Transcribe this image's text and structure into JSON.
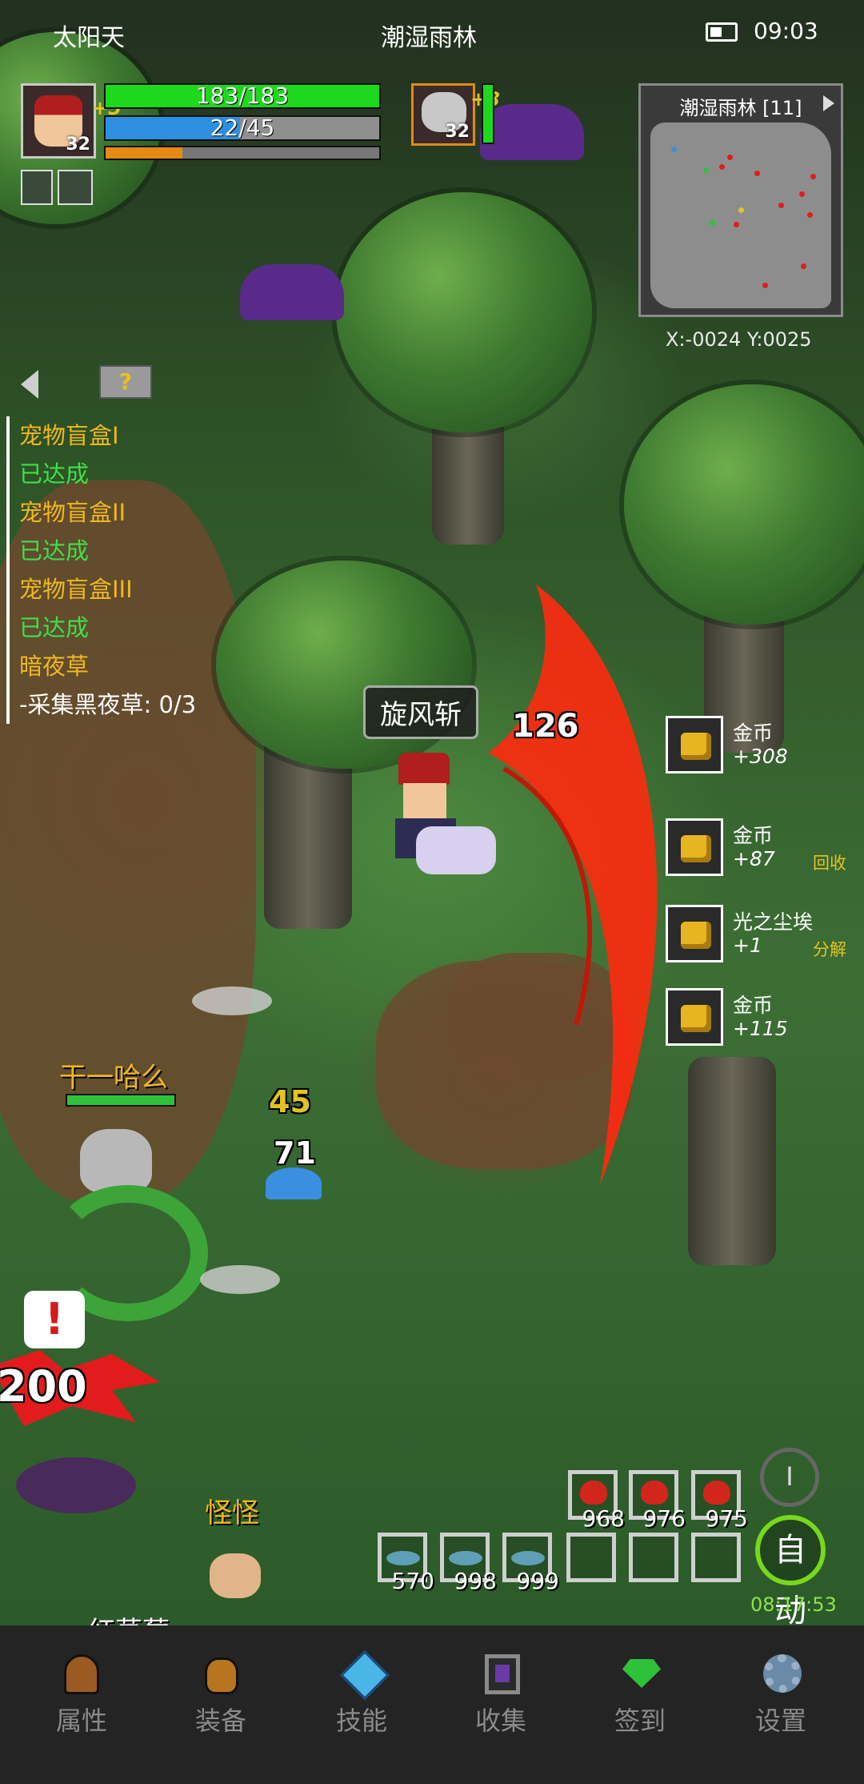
{
  "status": {
    "weather": "太阳天",
    "map_name": "潮湿雨林",
    "time": "09:03"
  },
  "player": {
    "level": "32",
    "bonus": "+5",
    "hp": "183/183",
    "hp_fraction": 1.0,
    "mp": "22/45",
    "mp_fraction": 0.49,
    "xp_fraction": 0.28
  },
  "pet": {
    "level": "32",
    "bonus": "+8",
    "hp_fraction": 1.0
  },
  "minimap": {
    "title": "潮湿雨林 [11]",
    "coords": "X:-0024  Y:0025"
  },
  "quests": [
    {
      "text": "宠物盲盒I",
      "color": "y"
    },
    {
      "text": "已达成",
      "color": "g"
    },
    {
      "text": "宠物盲盒II",
      "color": "y"
    },
    {
      "text": "已达成",
      "color": "g"
    },
    {
      "text": "宠物盲盒III",
      "color": "y"
    },
    {
      "text": "已达成",
      "color": "g"
    },
    {
      "text": "暗夜草",
      "color": "y"
    },
    {
      "text": "-采集黑夜草: 0/3",
      "color": "w"
    }
  ],
  "combat": {
    "skill_name": "旋风斩",
    "damage_main": "126",
    "damage_a": "45",
    "damage_b": "71",
    "damage_c": "200"
  },
  "loot": [
    {
      "name": "金币",
      "amount": "+308",
      "action": ""
    },
    {
      "name": "金币",
      "amount": "+87",
      "action": "回收"
    },
    {
      "name": "光之尘埃",
      "amount": "+1",
      "action": "分解"
    },
    {
      "name": "金币",
      "amount": "+115",
      "action": ""
    }
  ],
  "enemies": {
    "enemy1": "干一哈么",
    "enemy2": "怪怪",
    "enemy3": "红草莓"
  },
  "quickbar": {
    "top": [
      "968",
      "976",
      "975"
    ],
    "bottom": [
      "570",
      "998",
      "999"
    ]
  },
  "auto": {
    "label": "自动",
    "timer": "08:17:53",
    "pause": "I"
  },
  "nav": [
    "属性",
    "装备",
    "技能",
    "收集",
    "签到",
    "设置"
  ],
  "colors": {
    "hp": "#1ed81e",
    "mp": "#2c8fe0",
    "xp": "#e58a12",
    "quest_done": "#3ee04a",
    "quest_title": "#f0b820",
    "slash": "#ff2a10"
  }
}
